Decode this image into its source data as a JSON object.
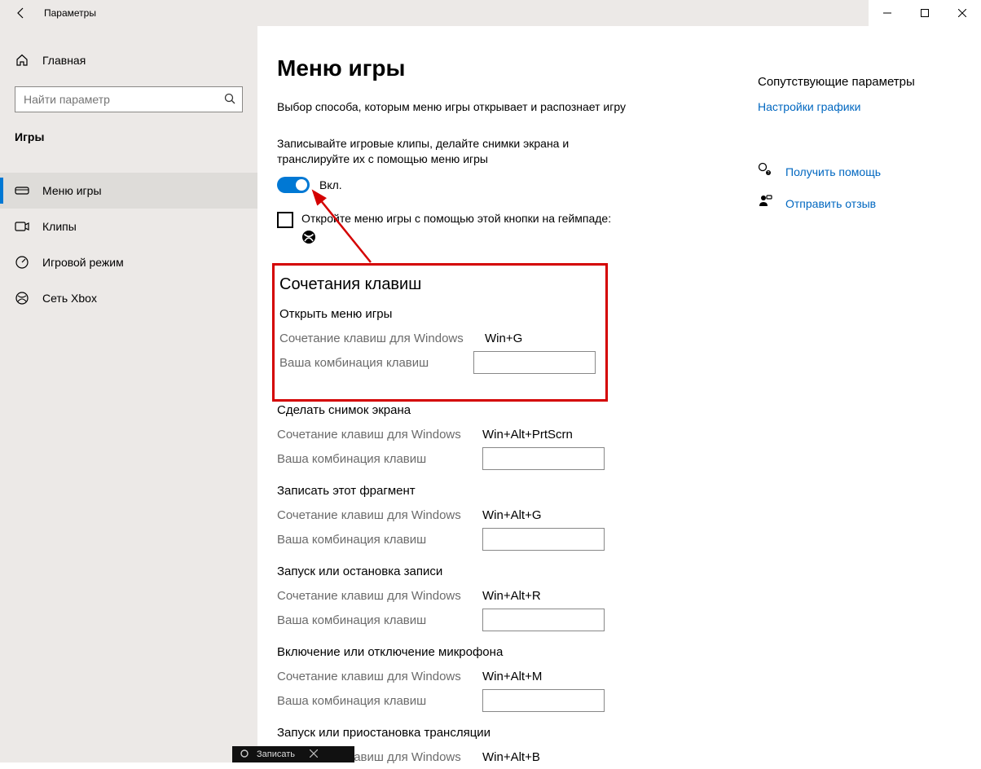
{
  "window": {
    "app_title": "Параметры"
  },
  "sidebar": {
    "home_label": "Главная",
    "search_placeholder": "Найти параметр",
    "category_label": "Игры",
    "items": [
      {
        "label": "Меню игры"
      },
      {
        "label": "Клипы"
      },
      {
        "label": "Игровой режим"
      },
      {
        "label": "Сеть Xbox"
      }
    ]
  },
  "main": {
    "page_title": "Меню игры",
    "desc": "Выбор способа, которым меню игры открывает и распознает игру",
    "record_desc": "Записывайте игровые клипы, делайте снимки экрана и транслируйте их с помощью меню игры",
    "toggle_state": "Вкл.",
    "gamepad_text": "Откройте меню игры с помощью этой кнопки на геймпаде:",
    "shortcuts_heading": "Сочетания клавиш",
    "shortcut_labels": {
      "win_label": "Сочетание клавиш для Windows",
      "user_label": "Ваша комбинация клавиш"
    },
    "shortcuts": [
      {
        "title": "Открыть меню игры",
        "win": "Win+G"
      },
      {
        "title": "Сделать снимок экрана",
        "win": "Win+Alt+PrtScrn"
      },
      {
        "title": "Записать этот фрагмент",
        "win": "Win+Alt+G"
      },
      {
        "title": "Запуск или остановка записи",
        "win": "Win+Alt+R"
      },
      {
        "title": "Включение или отключение микрофона",
        "win": "Win+Alt+M"
      },
      {
        "title": "Запуск или приостановка трансляции",
        "win": "Win+Alt+B"
      }
    ]
  },
  "aside": {
    "related_title": "Сопутствующие параметры",
    "graphics_link": "Настройки графики",
    "help_label": "Получить помощь",
    "feedback_label": "Отправить отзыв"
  },
  "bottom": {
    "record_label": "Записать"
  }
}
